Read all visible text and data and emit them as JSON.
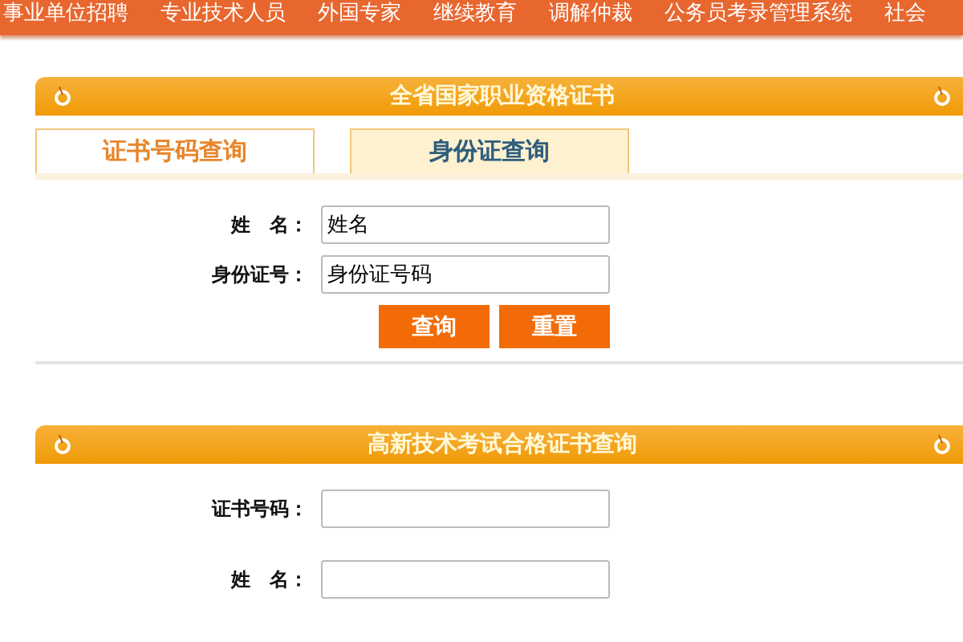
{
  "nav": {
    "items": [
      "事业单位招聘",
      "专业技术人员",
      "外国专家",
      "继续教育",
      "调解仲裁",
      "公务员考录管理系统",
      "社会"
    ]
  },
  "panels": [
    {
      "title": "全省国家职业资格证书",
      "tabs": [
        {
          "label": "证书号码查询",
          "selected": false
        },
        {
          "label": "身份证查询",
          "selected": true
        }
      ],
      "fields": [
        {
          "label": "姓　名：",
          "value": "姓名"
        },
        {
          "label": "身份证号：",
          "value": "身份证号码"
        }
      ],
      "buttons": [
        "查询",
        "重置"
      ]
    },
    {
      "title": "高新技术考试合格证书查询",
      "fields": [
        {
          "label": "证书号码："
        },
        {
          "label": "姓　名："
        }
      ]
    }
  ]
}
